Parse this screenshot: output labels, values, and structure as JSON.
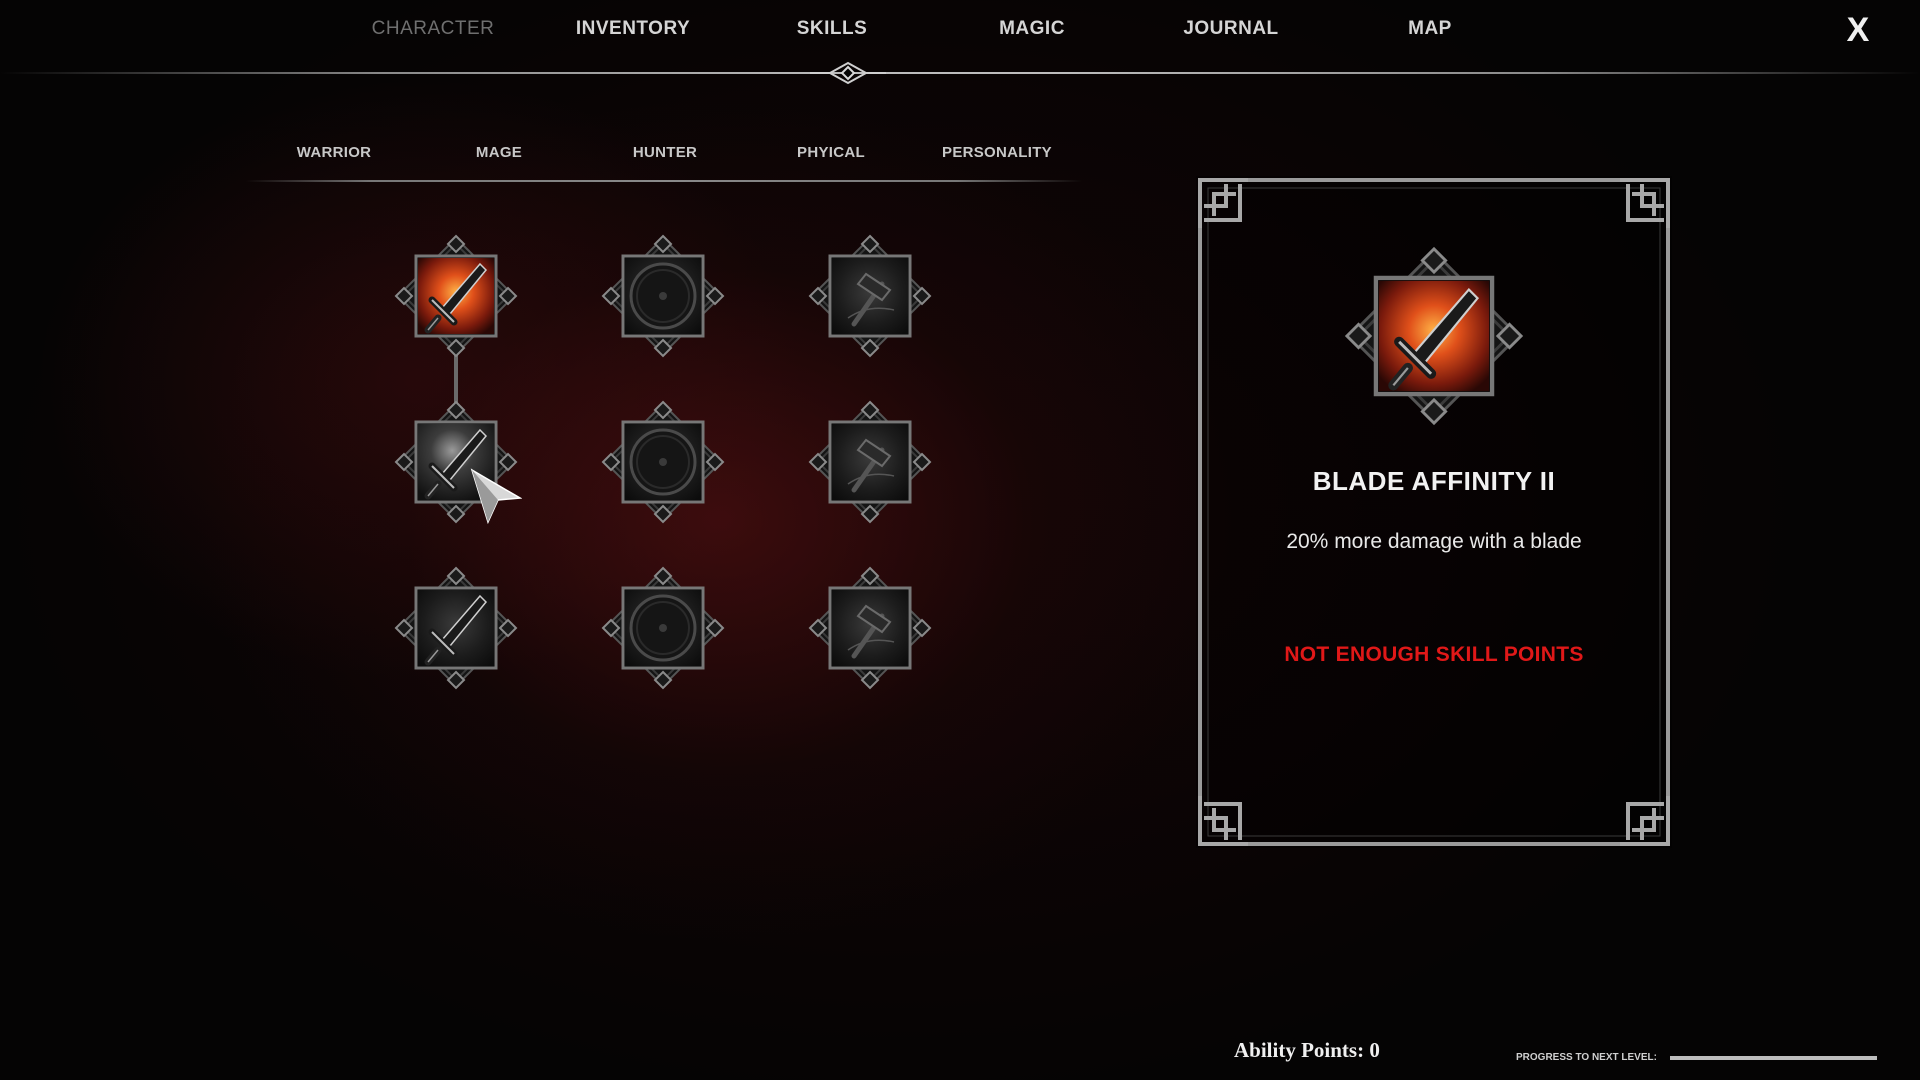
{
  "top_nav": {
    "tabs": [
      {
        "label": "CHARACTER"
      },
      {
        "label": "INVENTORY"
      },
      {
        "label": "SKILLS"
      },
      {
        "label": "MAGIC"
      },
      {
        "label": "JOURNAL"
      },
      {
        "label": "MAP"
      }
    ],
    "active_tab": "SKILLS",
    "close_label": "X"
  },
  "sub_tabs": {
    "tabs": [
      {
        "label": "WARRIOR"
      },
      {
        "label": "MAGE"
      },
      {
        "label": "HUNTER"
      },
      {
        "label": "PHYICAL"
      },
      {
        "label": "PERSONALITY"
      }
    ],
    "active_tab": "WARRIOR"
  },
  "skill_tree": {
    "nodes": [
      {
        "icon": "sword-icon",
        "state": "unlocked"
      },
      {
        "icon": "shield-icon",
        "state": "locked"
      },
      {
        "icon": "hammer-icon",
        "state": "locked"
      },
      {
        "icon": "sword-icon",
        "state": "hovered"
      },
      {
        "icon": "shield-icon",
        "state": "locked"
      },
      {
        "icon": "hammer-icon",
        "state": "locked"
      },
      {
        "icon": "sword-icon",
        "state": "locked"
      },
      {
        "icon": "shield-icon",
        "state": "locked"
      },
      {
        "icon": "hammer-icon",
        "state": "locked"
      }
    ]
  },
  "detail_panel": {
    "icon": "sword-icon",
    "title": "BLADE AFFINITY II",
    "description": "20% more damage with a blade",
    "warning": "NOT ENOUGH SKILL POINTS",
    "warning_color": "#e01818"
  },
  "footer": {
    "ability_points": "Ability Points: 0",
    "progress_label": "PROGRESS TO NEXT LEVEL:",
    "progress_value": 1.0
  },
  "colors": {
    "accent_fire": "#e0501a",
    "frame_silver": "#9a9a9a",
    "background": "#050404"
  }
}
